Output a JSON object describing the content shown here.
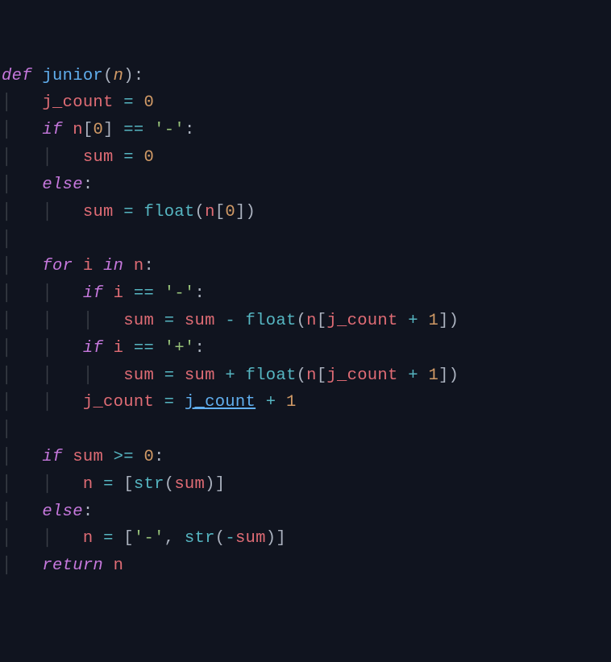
{
  "tokens": {
    "def": "def",
    "junior": "junior",
    "lp": "(",
    "n": "n",
    "rp": ")",
    "colon": ":",
    "j_count": "j_count",
    "eq": "=",
    "zero": "0",
    "if": "if",
    "lb": "[",
    "rb": "]",
    "eqeq": "==",
    "dash_str": "'-'",
    "sum": "sum",
    "else": "else",
    "float": "float",
    "for": "for",
    "i": "i",
    "in": "in",
    "minus": "-",
    "plus": "+",
    "plus_str": "'+'",
    "one": "1",
    "j_count_ref": "j_count",
    "gte": ">=",
    "str": "str",
    "comma": ",",
    "neg": "-",
    "return": "return"
  },
  "indent": {
    "g": "│",
    "sp4": "    ",
    "sp3": "   "
  }
}
